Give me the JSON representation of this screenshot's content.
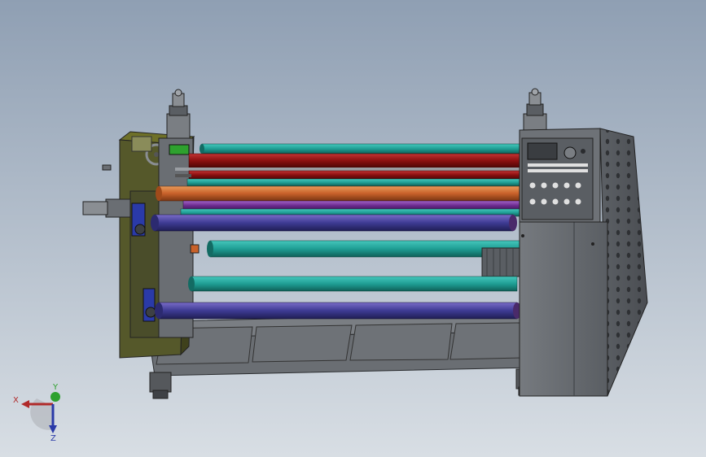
{
  "viewport": {
    "background_top": "#8f9fb3",
    "background_bottom": "#d8dee4"
  },
  "machine": {
    "frame_color": "#63666a",
    "frame_dark": "#3d4044",
    "left_plate_color": "#55582a",
    "roller_colors": [
      "#1f9e94",
      "#8c1010",
      "#8c1a26",
      "#c8612a",
      "#6b2a8e",
      "#3e3b93"
    ]
  },
  "triad": {
    "x_label": "X",
    "y_label": "Y",
    "z_label": "Z",
    "x_color": "#b02a2a",
    "y_color": "#2ea12e",
    "z_color": "#2a3aa8"
  }
}
